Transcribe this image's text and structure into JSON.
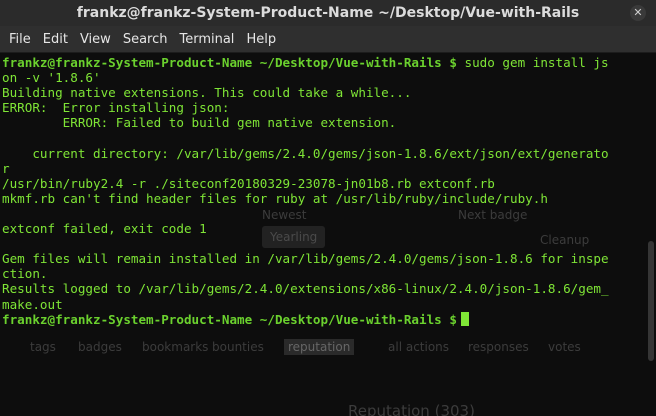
{
  "window": {
    "title": "frankz@frankz-System-Product-Name ~/Desktop/Vue-with-Rails"
  },
  "menu": [
    "File",
    "Edit",
    "View",
    "Search",
    "Terminal",
    "Help"
  ],
  "terminal": {
    "prompt": "frankz@frankz-System-Product-Name ~/Desktop/Vue-with-Rails $",
    "command": " sudo gem install js",
    "lines": [
      "on -v '1.8.6'",
      "Building native extensions. This could take a while...",
      "ERROR:  Error installing json:",
      "        ERROR: Failed to build gem native extension.",
      "",
      "    current directory: /var/lib/gems/2.4.0/gems/json-1.8.6/ext/json/ext/generato",
      "r",
      "/usr/bin/ruby2.4 -r ./siteconf20180329-23078-jn01b8.rb extconf.rb",
      "mkmf.rb can't find header files for ruby at /usr/lib/ruby/include/ruby.h",
      "",
      "extconf failed, exit code 1",
      "",
      "Gem files will remain installed in /var/lib/gems/2.4.0/gems/json-1.8.6 for inspe",
      "ction.",
      "Results logged to /var/lib/gems/2.4.0/extensions/x86-linux/2.4.0/json-1.8.6/gem_",
      "make.out"
    ],
    "final_prompt": "frankz@frankz-System-Product-Name ~/Desktop/Vue-with-Rails $"
  },
  "background_ghost": {
    "newest": "Newest",
    "next_badge": "Next badge",
    "badge": "Yearling",
    "cleanup": "Cleanup",
    "tabs": [
      "tags",
      "badges",
      "bookmarks",
      "bounties",
      "reputation",
      "all actions",
      "responses",
      "votes"
    ],
    "reputation": "Reputation",
    "reputation_count": "(303)"
  },
  "colors": {
    "text": "#7fe536",
    "background": "#0d0d0d"
  }
}
